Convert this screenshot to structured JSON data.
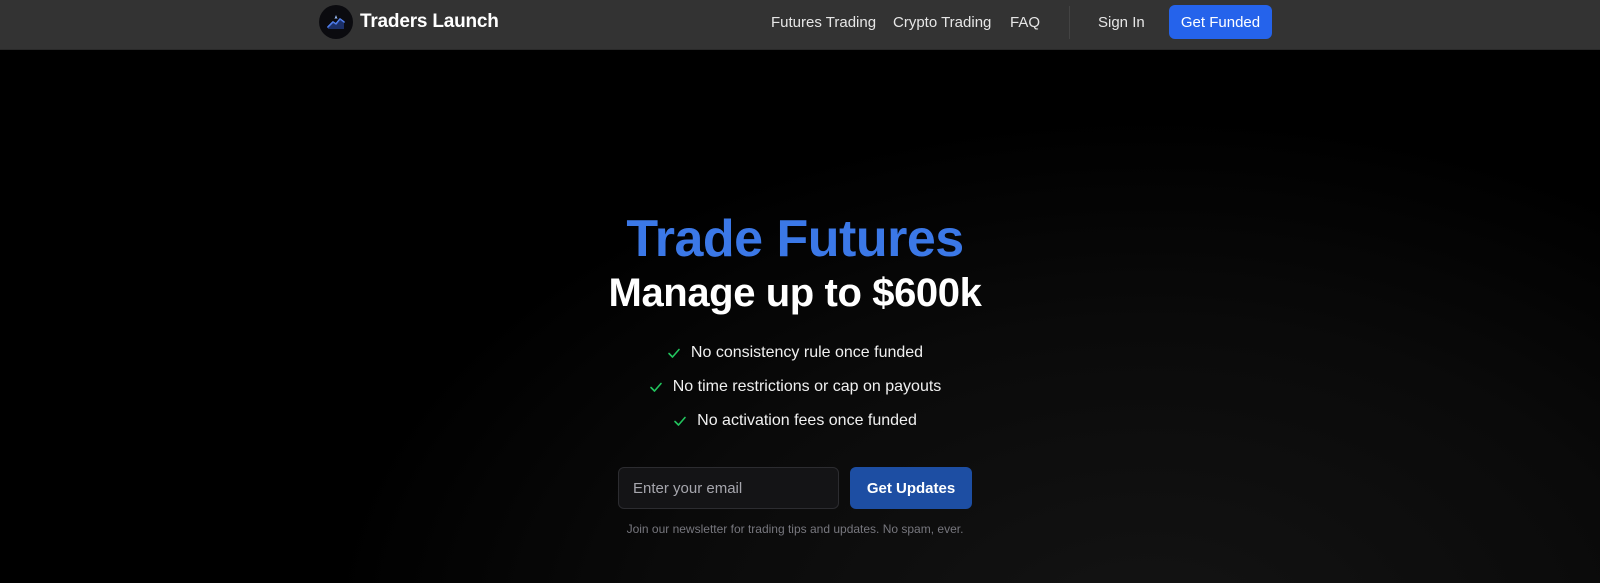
{
  "header": {
    "brand": {
      "name": "Traders Launch",
      "logo_icon": "rocket-chart-logo-icon"
    },
    "nav": {
      "futures_trading": "Futures Trading",
      "crypto_trading": "Crypto Trading",
      "faq": "FAQ",
      "sign_in": "Sign In",
      "get_funded": "Get Funded"
    }
  },
  "hero": {
    "title": "Trade Futures",
    "subtitle": "Manage up to $600k",
    "features": [
      "No consistency rule once funded",
      "No time restrictions or cap on payouts",
      "No activation fees once funded"
    ],
    "feature_icon": "check-icon"
  },
  "newsletter": {
    "email_placeholder": "Enter your email",
    "email_value": "",
    "button_label": "Get Updates",
    "note": "Join our newsletter for trading tips and updates. No spam, ever."
  },
  "colors": {
    "accent_blue": "#3b78e7",
    "cta_blue": "#2563eb",
    "button_blue": "#1d4ea3",
    "check_green": "#22c55e",
    "header_bg": "#333333",
    "page_bg": "#000000"
  }
}
